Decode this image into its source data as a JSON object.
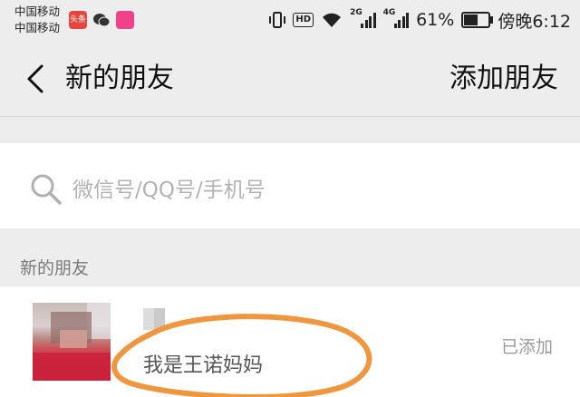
{
  "status_bar": {
    "carrier_1": "中国移动",
    "carrier_2": "中国移动",
    "toutiao_label": "头条",
    "network_1": "2G",
    "network_2": "4G",
    "hd_label": "HD",
    "battery_percent": "61%",
    "battery_level": 0.61,
    "time": "傍晚6:12"
  },
  "nav": {
    "title": "新的朋友",
    "action_label": "添加朋友"
  },
  "search": {
    "placeholder": "微信号/QQ号/手机号"
  },
  "section": {
    "title": "新的朋友"
  },
  "friends": [
    {
      "message": "我是王诺妈妈",
      "status": "已添加"
    }
  ],
  "colors": {
    "highlight_stroke": "#f0963e",
    "background": "#ededed"
  }
}
